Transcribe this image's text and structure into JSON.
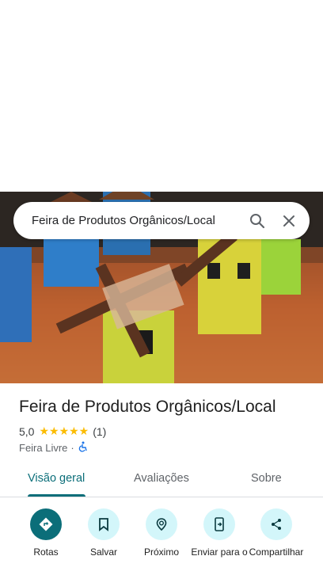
{
  "search": {
    "query": "Feira de Produtos Orgânicos/Local"
  },
  "place": {
    "name": "Feira de Produtos Orgânicos/Local",
    "rating": "5,0",
    "stars": "★★★★★",
    "review_count": "(1)",
    "category": "Feira Livre",
    "separator": "·"
  },
  "tabs": [
    {
      "label": "Visão geral",
      "active": true
    },
    {
      "label": "Avaliações",
      "active": false
    },
    {
      "label": "Sobre",
      "active": false
    }
  ],
  "actions": [
    {
      "label": "Rotas",
      "icon": "directions-icon"
    },
    {
      "label": "Salvar",
      "icon": "bookmark-icon"
    },
    {
      "label": "Próximo",
      "icon": "nearby-icon"
    },
    {
      "label": "Enviar para o",
      "icon": "send-to-phone-icon"
    },
    {
      "label": "Compartilhar",
      "icon": "share-icon"
    }
  ],
  "colors": {
    "accent": "#0b6e79",
    "action_bg": "#d3f6fa",
    "star": "#fbbc04"
  }
}
